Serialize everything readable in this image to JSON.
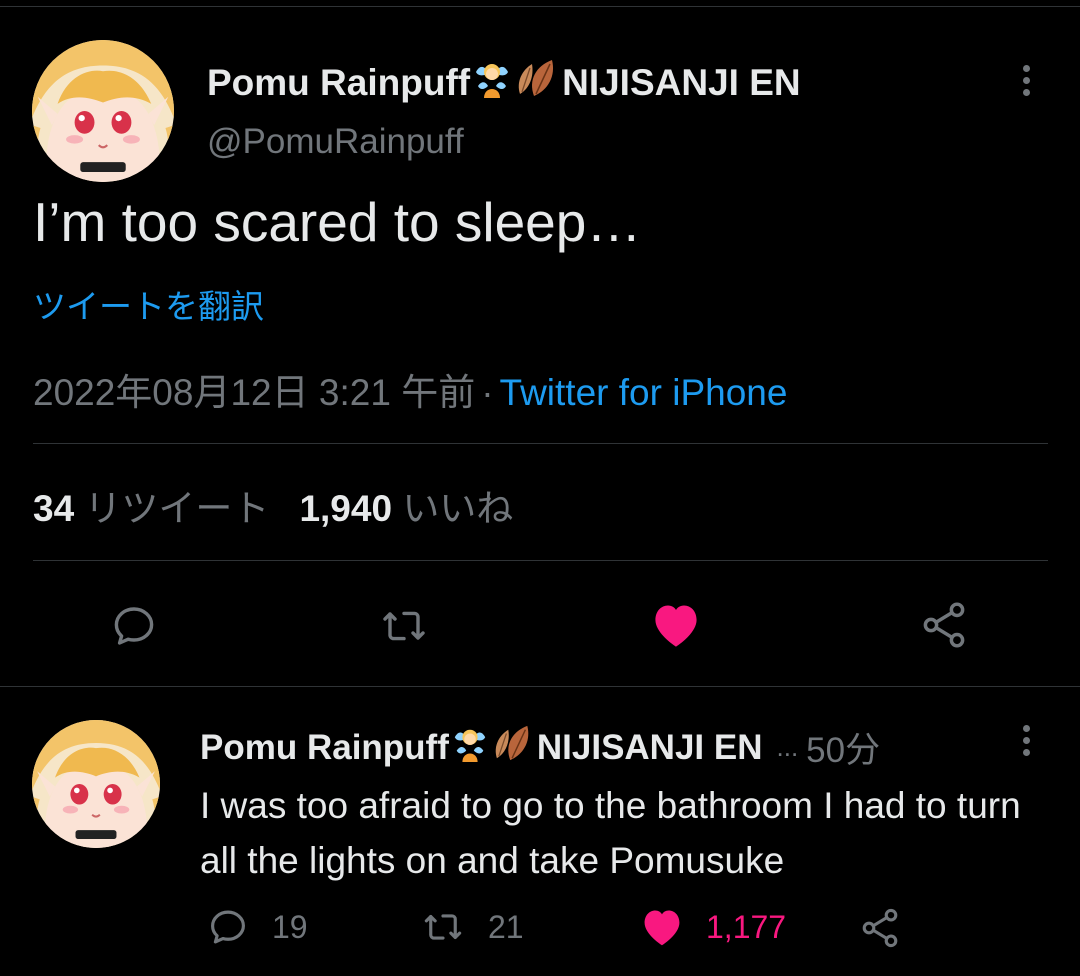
{
  "main_tweet": {
    "display_name": "Pomu Rainpuff",
    "name_suffix": "NIJISANJI EN",
    "handle": "@PomuRainpuff",
    "text": "I’m too scared to sleep…",
    "translate_label": "ツイートを翻訳",
    "timestamp": "2022年08月12日 3:21 午前",
    "separator": "·",
    "source": "Twitter for iPhone",
    "retweet_count": "34",
    "retweet_label": "リツイート",
    "like_count": "1,940",
    "like_label": "いいね",
    "liked": true
  },
  "reply_tweet": {
    "display_name": "Pomu Rainpuff",
    "name_suffix": "NIJISANJI EN",
    "overflow": "...",
    "time": "50分",
    "text": "I was too afraid to go to the bathroom I had to turn all the lights on and take Pomusuke",
    "reply_count": "19",
    "retweet_count": "21",
    "like_count": "1,177",
    "liked": true
  },
  "icons": [
    "more-vertical-icon",
    "reply-icon",
    "retweet-icon",
    "heart-icon",
    "share-icon",
    "fairy-emoji-icon",
    "leaf-emoji-icon"
  ],
  "colors": {
    "background": "#000000",
    "text_primary": "#e7e9ea",
    "text_secondary": "#71767b",
    "link": "#1d9bf0",
    "like": "#f91880",
    "divider": "#2f3336"
  }
}
